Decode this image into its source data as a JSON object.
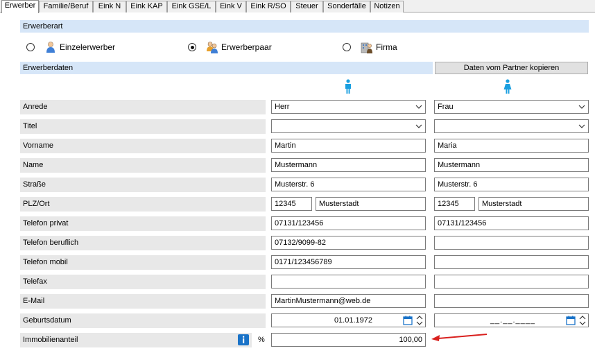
{
  "tabs": [
    "Erwerber",
    "Familie/Beruf",
    "Eink N",
    "Eink KAP",
    "Eink GSE/L",
    "Eink V",
    "Eink R/SO",
    "Steuer",
    "Sonderfälle",
    "Notizen"
  ],
  "erwerberart": {
    "title": "Erwerberart",
    "options": [
      {
        "label": "Einzelerwerber",
        "icon": "single-person-icon",
        "checked": false
      },
      {
        "label": "Erwerberpaar",
        "icon": "couple-icon",
        "checked": true
      },
      {
        "label": "Firma",
        "icon": "company-icon",
        "checked": false
      }
    ]
  },
  "erwerberdaten": {
    "title": "Erwerberdaten",
    "copy_button": "Daten vom Partner kopieren",
    "person1_icon": "male-icon",
    "person2_icon": "female-icon"
  },
  "fields": {
    "anrede": {
      "label": "Anrede",
      "p1": "Herr",
      "p2": "Frau"
    },
    "titel": {
      "label": "Titel",
      "p1": "",
      "p2": ""
    },
    "vorname": {
      "label": "Vorname",
      "p1": "Martin",
      "p2": "Maria"
    },
    "name": {
      "label": "Name",
      "p1": "Mustermann",
      "p2": "Mustermann"
    },
    "strasse": {
      "label": "Straße",
      "p1": "Musterstr. 6",
      "p2": "Musterstr. 6"
    },
    "plzort": {
      "label": "PLZ/Ort",
      "p1_plz": "12345",
      "p1_ort": "Musterstadt",
      "p2_plz": "12345",
      "p2_ort": "Musterstadt"
    },
    "tel_privat": {
      "label": "Telefon privat",
      "p1": "07131/123456",
      "p2": "07131/123456"
    },
    "tel_beruflich": {
      "label": "Telefon beruflich",
      "p1": "07132/9099-82",
      "p2": ""
    },
    "tel_mobil": {
      "label": "Telefon mobil",
      "p1": "0171/123456789",
      "p2": ""
    },
    "telefax": {
      "label": "Telefax",
      "p1": "",
      "p2": ""
    },
    "email": {
      "label": "E-Mail",
      "p1": "MartinMustermann@web.de",
      "p2": ""
    },
    "geburtsdatum": {
      "label": "Geburtsdatum",
      "p1": "01.01.1972",
      "p2": "__.__.____"
    },
    "immobilienanteil": {
      "label": "Immobilienanteil",
      "unit": "%",
      "value": "100,00"
    }
  },
  "colors": {
    "section_bar": "#d6e6f8",
    "label_bg": "#e8e8e8",
    "accent": "#1a9fe0",
    "arrow": "#d9201e"
  }
}
